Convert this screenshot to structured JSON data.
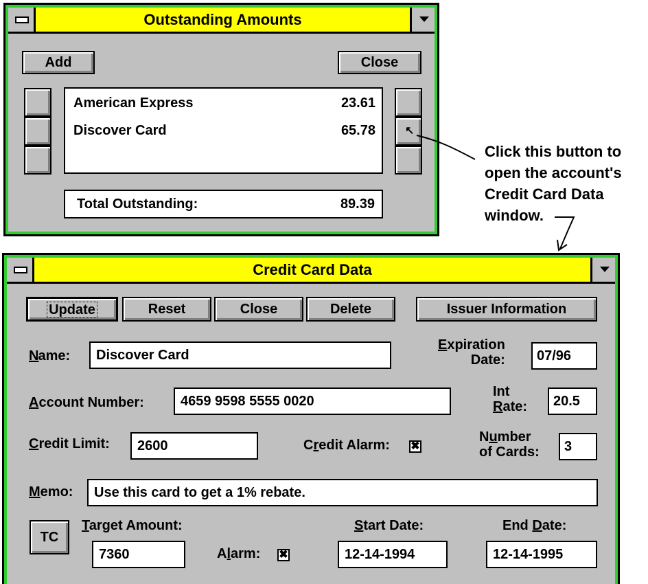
{
  "outstanding": {
    "title": "Outstanding Amounts",
    "add_label": "Add",
    "close_label": "Close",
    "accounts": [
      {
        "name": "American Express",
        "amount": "23.61"
      },
      {
        "name": "Discover Card",
        "amount": "65.78"
      }
    ],
    "total_label": "Total Outstanding:",
    "total_value": "89.39"
  },
  "annotation": {
    "lines": [
      "Click this button to",
      "open the account's",
      "Credit Card Data",
      "window."
    ]
  },
  "credit": {
    "title": "Credit Card Data",
    "buttons": {
      "update": "Update",
      "reset": "Reset",
      "close": "Close",
      "delete": "Delete",
      "issuer": "Issuer Information"
    },
    "name_label": "Name:",
    "name_value": "Discover Card",
    "expiration_label_1": "Expiration",
    "expiration_label_2": "Date:",
    "expiration_value": "07/96",
    "account_label": "Account Number:",
    "account_value": "4659 9598 5555 0020",
    "int_rate_label_1": "Int",
    "int_rate_label_2": "Rate:",
    "int_rate_value": "20.5",
    "credit_limit_label": "Credit Limit:",
    "credit_limit_value": "2600",
    "credit_alarm_label": "Credit Alarm:",
    "credit_alarm_checked": true,
    "num_cards_label_1": "Number",
    "num_cards_label_2": "of Cards:",
    "num_cards_value": "3",
    "memo_label": "Memo:",
    "memo_value": "Use this card to get a 1% rebate.",
    "tc_label": "TC",
    "target_label": "Target Amount:",
    "target_value": "7360",
    "alarm_label": "Alarm:",
    "alarm_checked": true,
    "start_label": "Start Date:",
    "start_value": "12-14-1994",
    "end_label": "End Date:",
    "end_value": "12-14-1995"
  },
  "colors": {
    "titlebar": "#ffff00",
    "frame": "#33cc33",
    "face": "#c0c0c0"
  }
}
